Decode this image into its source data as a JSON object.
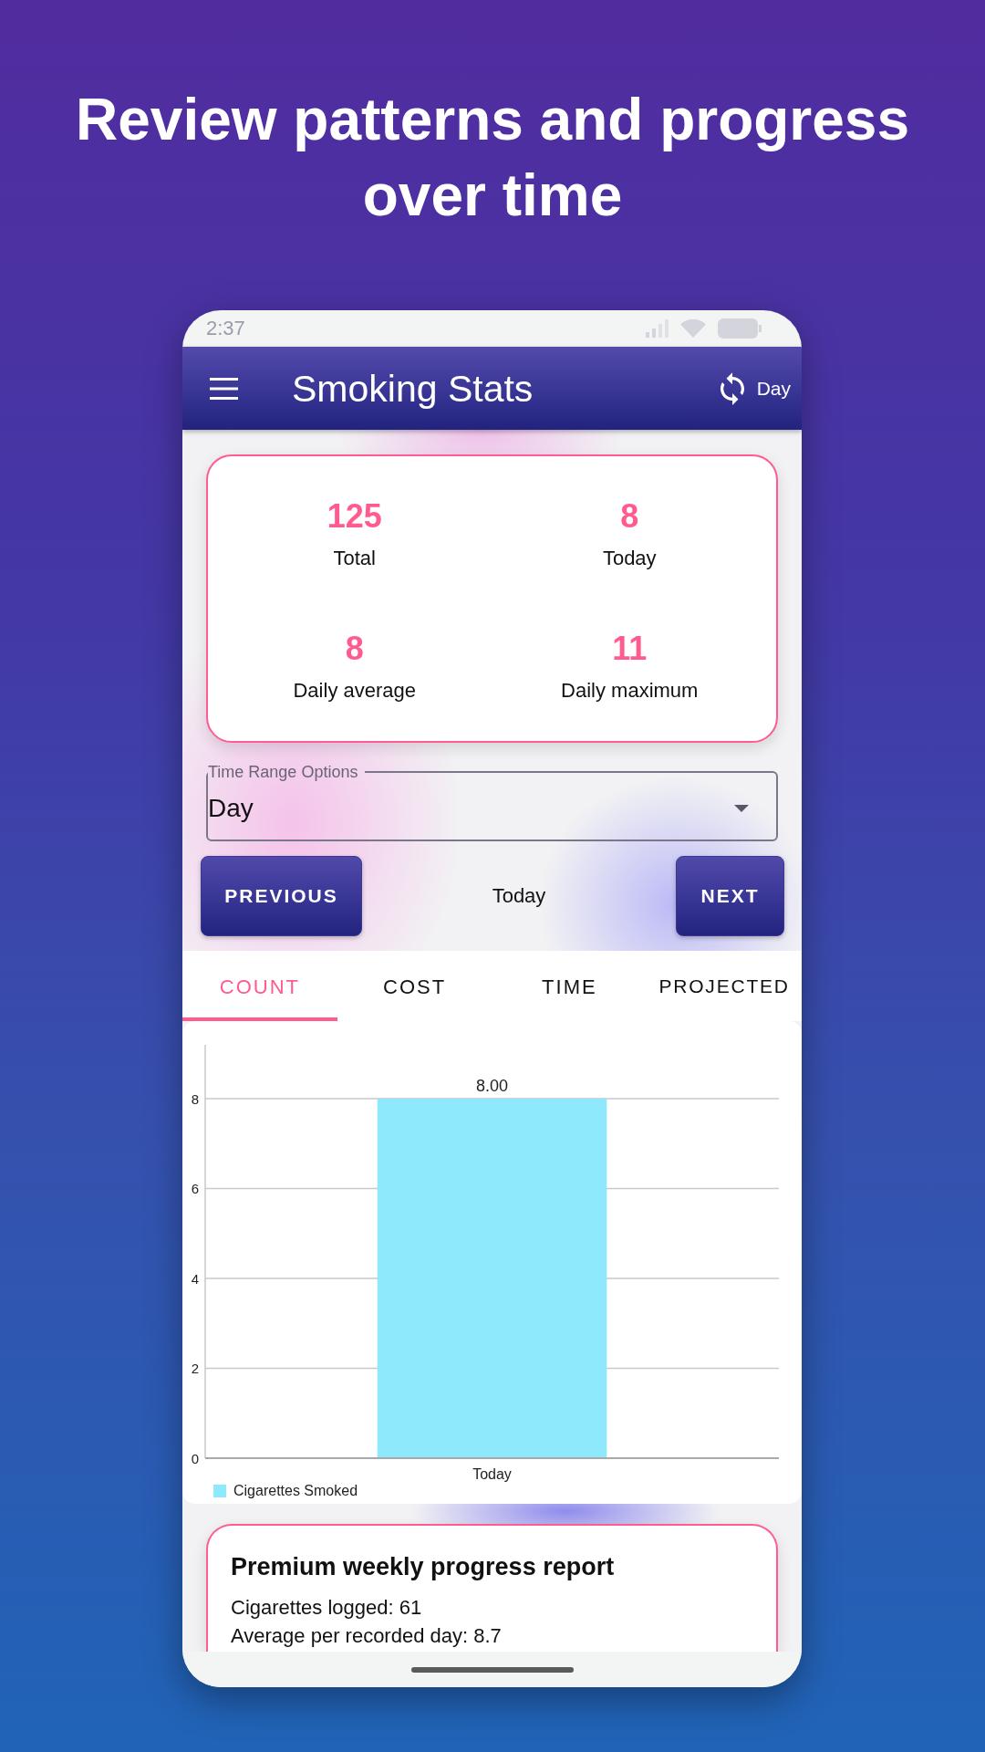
{
  "headline": "Review patterns and progress over time",
  "status_bar": {
    "time": "2:37"
  },
  "app_bar": {
    "title": "Smoking Stats",
    "range_button": "Day"
  },
  "stats": [
    {
      "value": "125",
      "label": "Total"
    },
    {
      "value": "8",
      "label": "Today"
    },
    {
      "value": "8",
      "label": "Daily average"
    },
    {
      "value": "11",
      "label": "Daily maximum"
    }
  ],
  "time_range": {
    "label": "Time Range Options",
    "value": "Day"
  },
  "navigation": {
    "previous": "PREVIOUS",
    "current": "Today",
    "next": "NEXT"
  },
  "tabs": [
    {
      "label": "COUNT",
      "selected": true
    },
    {
      "label": "COST",
      "selected": false
    },
    {
      "label": "TIME",
      "selected": false
    },
    {
      "label": "PROJECTED",
      "selected": false
    }
  ],
  "chart": {
    "chart_data": {
      "type": "bar",
      "categories": [
        "Today"
      ],
      "series": [
        {
          "name": "Cigarettes Smoked",
          "color": "#8ee9fc",
          "values": [
            8
          ]
        }
      ],
      "ylim": [
        0,
        9.2
      ],
      "yticks": [
        0,
        2,
        4,
        6,
        8
      ],
      "grid": true,
      "value_labels": [
        "8.00"
      ]
    }
  },
  "report": {
    "title": "Premium weekly progress report",
    "lines": [
      "Cigarettes logged: 61",
      "Average per recorded day: 8.7"
    ]
  }
}
